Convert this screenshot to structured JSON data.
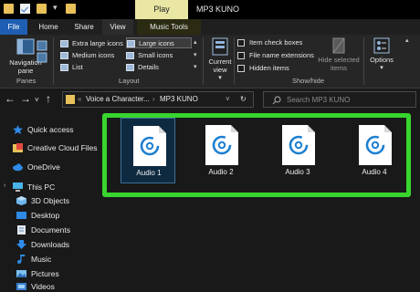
{
  "titlebar": {
    "play_tab": "Play",
    "window_title": "MP3 KUNO"
  },
  "tabs": [
    {
      "label": "File"
    },
    {
      "label": "Home"
    },
    {
      "label": "Share"
    },
    {
      "label": "View"
    },
    {
      "label": "Music Tools"
    }
  ],
  "ribbon": {
    "panes": {
      "navigation_pane": "Navigation pane",
      "group_label": "Panes"
    },
    "layout": {
      "group_label": "Layout",
      "items": [
        "Extra large icons",
        "Large icons",
        "Medium icons",
        "Small icons",
        "List",
        "Details"
      ],
      "selected": "Large icons"
    },
    "current_view": {
      "label": "Current view"
    },
    "show_hide": {
      "group_label": "Show/hide",
      "checkboxes": [
        "Item check boxes",
        "File name extensions",
        "Hidden items"
      ],
      "hide_selected": "Hide selected items",
      "options": "Options"
    }
  },
  "address": {
    "crumbs": [
      "Voice a Character...",
      "MP3 KUNO"
    ],
    "search_placeholder": "Search MP3 KUNO"
  },
  "sidebar": {
    "items": [
      {
        "label": "Quick access",
        "icon": "star-icon"
      },
      {
        "label": "Creative Cloud Files",
        "icon": "creative-cloud-icon"
      },
      {
        "label": "OneDrive",
        "icon": "cloud-icon"
      },
      {
        "label": "This PC",
        "icon": "computer-icon"
      },
      {
        "label": "3D Objects",
        "icon": "cube-icon"
      },
      {
        "label": "Desktop",
        "icon": "desktop-icon"
      },
      {
        "label": "Documents",
        "icon": "documents-icon"
      },
      {
        "label": "Downloads",
        "icon": "download-icon"
      },
      {
        "label": "Music",
        "icon": "music-icon"
      },
      {
        "label": "Pictures",
        "icon": "pictures-icon"
      },
      {
        "label": "Videos",
        "icon": "videos-icon"
      }
    ]
  },
  "files": [
    {
      "name": "Audio 1",
      "selected": true
    },
    {
      "name": "Audio 2",
      "selected": false
    },
    {
      "name": "Audio 3",
      "selected": false
    },
    {
      "name": "Audio 4",
      "selected": false
    }
  ],
  "colors": {
    "accent": "#1e5fb3",
    "highlight": "#39d52f",
    "music_tools": "#e9e7a3",
    "audio_icon": "#1e7fd0"
  }
}
